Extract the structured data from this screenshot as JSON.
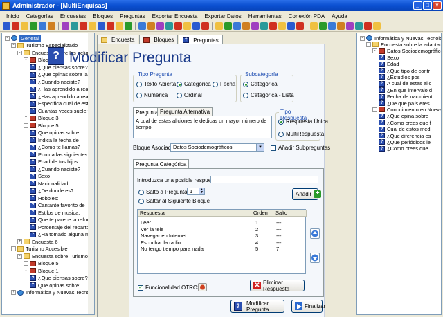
{
  "window": {
    "title": "Administrador - [MultiEnquisas]"
  },
  "menu": [
    "Inicio",
    "Categorías",
    "Encuestas",
    "Bloques",
    "Preguntas",
    "Exportar Encuesta",
    "Exportar Datos",
    "Herramientas",
    "Conexión PDA",
    "Ayuda"
  ],
  "left_tree": [
    {
      "label": "General",
      "level": 0,
      "icon": "globe",
      "exp": "-",
      "selected": true
    },
    {
      "label": "Turismo Especializado",
      "level": 1,
      "icon": "folder",
      "exp": "-"
    },
    {
      "label": "Encuesta sobre los peligros de la",
      "level": 2,
      "icon": "folder",
      "exp": "-"
    },
    {
      "label": "Bloque 1",
      "level": 3,
      "icon": "book",
      "exp": "-"
    },
    {
      "label": "¿Que piensas sobre?",
      "level": 4,
      "icon": "q"
    },
    {
      "label": "¿Que opinas sobre las e",
      "level": 4,
      "icon": "q"
    },
    {
      "label": "¿Cuando naciste?",
      "level": 4,
      "icon": "q"
    },
    {
      "label": "¿Has aprendido a realiza",
      "level": 4,
      "icon": "q"
    },
    {
      "label": "¿Has aprendido a realiza",
      "level": 4,
      "icon": "q"
    },
    {
      "label": "Especifica cual de estos",
      "level": 4,
      "icon": "q"
    },
    {
      "label": "Cuantas veces suele vis",
      "level": 4,
      "icon": "q"
    },
    {
      "label": "Bloque 3",
      "level": 3,
      "icon": "book",
      "exp": "+"
    },
    {
      "label": "Bloque 5",
      "level": 3,
      "icon": "book",
      "exp": "-"
    },
    {
      "label": "Que opinas sobre:",
      "level": 4,
      "icon": "q"
    },
    {
      "label": "Indica la fecha de",
      "level": 4,
      "icon": "q"
    },
    {
      "label": "¿Como te llamas?",
      "level": 4,
      "icon": "q"
    },
    {
      "label": "Puntua las siguientes ley",
      "level": 4,
      "icon": "q"
    },
    {
      "label": "Edad de tus hijos",
      "level": 4,
      "icon": "q"
    },
    {
      "label": "¿Cuando naciste?",
      "level": 4,
      "icon": "q"
    },
    {
      "label": "Sexo",
      "level": 4,
      "icon": "q"
    },
    {
      "label": "Nacionalidad:",
      "level": 4,
      "icon": "q"
    },
    {
      "label": "¿De donde es?",
      "level": 4,
      "icon": "q"
    },
    {
      "label": "Hobbies:",
      "level": 4,
      "icon": "q"
    },
    {
      "label": "Cantante favorito de",
      "level": 4,
      "icon": "q"
    },
    {
      "label": "Estilos de musica:",
      "level": 4,
      "icon": "q"
    },
    {
      "label": "Que te parece la reforma",
      "level": 4,
      "icon": "q"
    },
    {
      "label": "Porcentaje del reparto d",
      "level": 4,
      "icon": "q"
    },
    {
      "label": "¿Ha tomado alguna mic",
      "level": 4,
      "icon": "q"
    },
    {
      "label": "Encuesta 6",
      "level": 2,
      "icon": "folder",
      "exp": "+"
    },
    {
      "label": "Turismo Accesible",
      "level": 1,
      "icon": "folder",
      "exp": "-"
    },
    {
      "label": "Encuesta sobre Turismo Accesible",
      "level": 2,
      "icon": "folder",
      "exp": "-"
    },
    {
      "label": "Bloque 5",
      "level": 3,
      "icon": "book",
      "exp": "+"
    },
    {
      "label": "Bloque 1",
      "level": 3,
      "icon": "book",
      "exp": "-"
    },
    {
      "label": "¿Que piensas sobre?",
      "level": 4,
      "icon": "q"
    },
    {
      "label": "Que opinas sobre:",
      "level": 4,
      "icon": "q"
    },
    {
      "label": "Informática y Nuevas Tecnologías",
      "level": 1,
      "icon": "globe",
      "exp": "+"
    }
  ],
  "right_tree": [
    {
      "label": "Informática y Nuevas Tecnologías",
      "level": 0,
      "icon": "globe",
      "exp": "-"
    },
    {
      "label": "Encuesta sobre la adaptación",
      "level": 1,
      "icon": "folder",
      "exp": "-"
    },
    {
      "label": "Datos Sociodemográficos",
      "level": 2,
      "icon": "book",
      "exp": "-"
    },
    {
      "label": "Sexo",
      "level": 3,
      "icon": "q"
    },
    {
      "label": "Edad",
      "level": 3,
      "icon": "q"
    },
    {
      "label": "¿Que tipo de contr",
      "level": 3,
      "icon": "q"
    },
    {
      "label": "¿Estudios pos",
      "level": 3,
      "icon": "q"
    },
    {
      "label": "A cual de estas alic",
      "level": 3,
      "icon": "q"
    },
    {
      "label": "¿En que intervalo d",
      "level": 3,
      "icon": "q"
    },
    {
      "label": "Fecha de nacimient",
      "level": 3,
      "icon": "q"
    },
    {
      "label": "¿De que país eres",
      "level": 3,
      "icon": "q"
    },
    {
      "label": "Conocimiento en Nuevas",
      "level": 2,
      "icon": "book",
      "exp": "-"
    },
    {
      "label": "¿Que opina sobre",
      "level": 3,
      "icon": "q"
    },
    {
      "label": "¿Como crees que f",
      "level": 3,
      "icon": "q"
    },
    {
      "label": "Cual de estos medi",
      "level": 3,
      "icon": "q"
    },
    {
      "label": "¿Que diferencia es",
      "level": 3,
      "icon": "q"
    },
    {
      "label": "¿Que periódicos le",
      "level": 3,
      "icon": "q"
    },
    {
      "label": "¿Como crees que",
      "level": 3,
      "icon": "q"
    }
  ],
  "tabs": [
    "Encuesta",
    "Bloques",
    "Preguntas"
  ],
  "form": {
    "heading": "Modificar Pregunta",
    "tipo_legend": "Tipo Pregunta",
    "tipo": {
      "abierta": "Texto Abierta",
      "categorica": "Categórica",
      "fecha": "Fecha",
      "numerica": "Numérica",
      "ordinal": "Ordinal"
    },
    "subcat_legend": "Subcategoría",
    "subcat": {
      "categorica": "Categórica",
      "lista": "Categórica - Lista"
    },
    "tab_pregunta": "Pregunta",
    "tab_alternativa": "Pregunta Alternativa",
    "question_text": "A cual de estas aliciones le dedicas un mayor número de tiempo.",
    "tipo_resp_legend": "Tipo Respuesta",
    "tipo_resp": {
      "unica": "Respuesta Única",
      "multi": "MultiRespuesta"
    },
    "bloque_label": "Bloque Asociado:",
    "bloque_value": "Datos Sociodemográficos",
    "anadir_sub": "Añadir Subpreguntas",
    "tab_categorica": "Pregunta Categórica",
    "intro_label": "Introduzca una posible respuesta:",
    "salto_pregunta": "Salto a Pregunta:",
    "salto_value": "1",
    "salto_bloque": "Saltar al Siguiente Bloque",
    "anadir_btn": "Añadir",
    "col_respuesta": "Respuesta",
    "col_orden": "Orden",
    "col_salto": "Salto",
    "rows": [
      {
        "r": "Leer",
        "o": "1",
        "s": "---"
      },
      {
        "r": "Ver la tele",
        "o": "2",
        "s": "---"
      },
      {
        "r": "Navegar en Internet",
        "o": "3",
        "s": "---"
      },
      {
        "r": "Escuchar la radio",
        "o": "4",
        "s": "---"
      },
      {
        "r": "No tengo tiempo para nada",
        "o": "5",
        "s": "7"
      }
    ],
    "funcionalidad": "Funcionalidad OTROS",
    "eliminar_btn": "Eliminar Respuesta",
    "modificar_btn": "Modificar Pregunta",
    "finalizar_btn": "Finalizar"
  }
}
